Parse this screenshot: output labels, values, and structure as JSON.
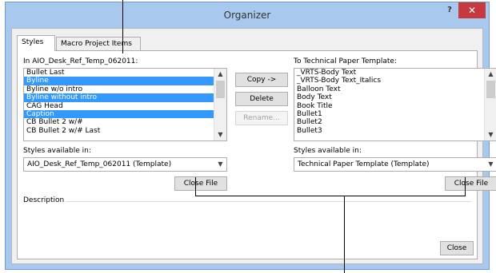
{
  "window": {
    "title": "Organizer",
    "help": "?",
    "close": "✕"
  },
  "tabs": [
    {
      "label": "Styles"
    },
    {
      "label": "Macro Project Items"
    }
  ],
  "left": {
    "label": "In AIO_Desk_Ref_Temp_062011:",
    "items": [
      {
        "label": "Bullet Last",
        "selected": false
      },
      {
        "label": "Byline",
        "selected": true
      },
      {
        "label": "Byline w/o intro",
        "selected": false
      },
      {
        "label": "Byline without intro",
        "selected": true
      },
      {
        "label": "CAG Head",
        "selected": false
      },
      {
        "label": "Caption",
        "selected": true
      },
      {
        "label": "CB Bullet 2 w/#",
        "selected": false
      },
      {
        "label": "CB Bullet 2 w/# Last",
        "selected": false
      }
    ],
    "available_label": "Styles available in:",
    "available_value": "AIO_Desk_Ref_Temp_062011 (Template)",
    "close_file": "Close File"
  },
  "right": {
    "label": "To Technical Paper Template:",
    "items": [
      {
        "label": "_VRTS-Body Text",
        "selected": false
      },
      {
        "label": "_VRTS-Body Text_Italics",
        "selected": false
      },
      {
        "label": "Balloon Text",
        "selected": false
      },
      {
        "label": "Body Text",
        "selected": false
      },
      {
        "label": "Book Title",
        "selected": false
      },
      {
        "label": "Bullet1",
        "selected": false
      },
      {
        "label": "Bullet2",
        "selected": false
      },
      {
        "label": "Bullet3",
        "selected": false
      }
    ],
    "available_label": "Styles available in:",
    "available_value": "Technical Paper Template (Template)",
    "close_file": "Close File"
  },
  "actions": {
    "copy": "Copy ->",
    "delete": "Delete",
    "rename": "Rename..."
  },
  "description_label": "Description",
  "close_button": "Close",
  "colors": {
    "selection": "#3399ff",
    "frame": "#a9c8ee",
    "close_red": "#c7383f"
  },
  "icons": {
    "scroll_up": "▲",
    "scroll_down": "▼",
    "dropdown": "▼"
  }
}
